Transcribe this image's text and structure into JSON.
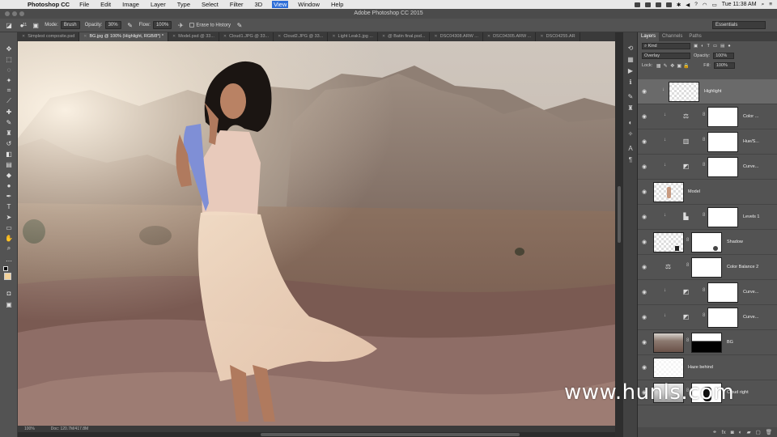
{
  "menubar": {
    "app_name": "Photoshop CC",
    "items": [
      "File",
      "Edit",
      "Image",
      "Layer",
      "Type",
      "Select",
      "Filter",
      "3D",
      "View",
      "Window",
      "Help"
    ],
    "active_item": "View",
    "clock": "Tue 11:38 AM"
  },
  "window": {
    "title": "Adobe Photoshop CC 2015"
  },
  "options": {
    "mode_label": "Mode:",
    "mode_value": "Brush",
    "opacity_label": "Opacity:",
    "opacity_value": "30%",
    "flow_label": "Flow:",
    "flow_value": "100%",
    "erase_to_history": "Erase to History",
    "workspace": "Essentials",
    "brush_size": "11"
  },
  "tabs": [
    {
      "label": "Simplest composite.psd",
      "active": false
    },
    {
      "label": "BG.jpg @ 100% (Highlight, RGB/8*) *",
      "active": true
    },
    {
      "label": "Model.psd @ 33...",
      "active": false
    },
    {
      "label": "Cloud1.JPG @ 33...",
      "active": false
    },
    {
      "label": "Cloud2.JPG @ 33...",
      "active": false
    },
    {
      "label": "Light Leak1.jpg ...",
      "active": false
    },
    {
      "label": "@ Batin final.psd...",
      "active": false
    },
    {
      "label": "DSC04308.ARW ...",
      "active": false
    },
    {
      "label": "DSC04305.ARW ...",
      "active": false
    },
    {
      "label": "DSC04255.AR",
      "active": false
    }
  ],
  "status": {
    "zoom": "100%",
    "doc": "Doc: 120.7M/417.8M"
  },
  "panel": {
    "tabs": [
      "Layers",
      "Channels",
      "Paths"
    ],
    "filter_kind": "Kind",
    "blend_mode": "Overlay",
    "opacity_label": "Opacity:",
    "opacity_value": "100%",
    "lock_label": "Lock:",
    "fill_label": "Fill:",
    "fill_value": "100%"
  },
  "layers": [
    {
      "name": "Highlight",
      "kind": "pixel",
      "selected": true
    },
    {
      "name": "Color ...",
      "kind": "adjustment",
      "icon": "color-balance"
    },
    {
      "name": "Hue/S...",
      "kind": "adjustment",
      "icon": "hue-saturation"
    },
    {
      "name": "Curve...",
      "kind": "adjustment",
      "icon": "curves"
    },
    {
      "name": "Model",
      "kind": "pixel"
    },
    {
      "name": "Levels 1",
      "kind": "adjustment",
      "icon": "levels"
    },
    {
      "name": "Shadow",
      "kind": "pixel-mask"
    },
    {
      "name": "Color Balance 2",
      "kind": "adjustment",
      "icon": "color-balance"
    },
    {
      "name": "Curve...",
      "kind": "adjustment",
      "icon": "curves"
    },
    {
      "name": "Curve...",
      "kind": "adjustment",
      "icon": "curves"
    },
    {
      "name": "BG",
      "kind": "pixel-mask"
    },
    {
      "name": "Haze behind",
      "kind": "pixel"
    },
    {
      "name": "Cloud right",
      "kind": "pixel-mask"
    }
  ],
  "watermark": "www.hunls.com"
}
